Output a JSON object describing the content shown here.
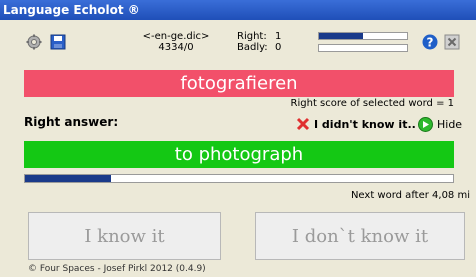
{
  "app": {
    "title": "Language Echolot ®"
  },
  "toolbar": {
    "dict_name": "<-en-ge.dic>",
    "dict_count": "4334/0",
    "right_label": "Right:",
    "right_value": "1",
    "badly_label": "Badly:",
    "badly_value": "0",
    "right_bar_fraction": 0.5,
    "badly_bar_fraction": 0,
    "icons": {
      "settings": "gear-icon",
      "save": "save-icon",
      "help": "help-icon",
      "close": "close-icon"
    }
  },
  "quiz": {
    "word": "fotografieren",
    "score_text": "Right score of selected word = 1",
    "right_answer_label": "Right answer:",
    "didnt_know_label": "I didn't know it..",
    "hide_label": "Hide",
    "answer": "to photograph",
    "progress_fraction": 0.2,
    "next_word_text": "Next word after 4,08 mi"
  },
  "buttons": {
    "know": "I know it",
    "dont_know": "I don`t know it"
  },
  "footer": {
    "copyright": "© Four Spaces - Josef Pirkl 2012 (0.4.9)"
  },
  "colors": {
    "word_bg": "#f2506a",
    "answer_bg": "#14c814",
    "title_bg": "#1f4fb8",
    "bar_fill": "#1a3a8a"
  }
}
